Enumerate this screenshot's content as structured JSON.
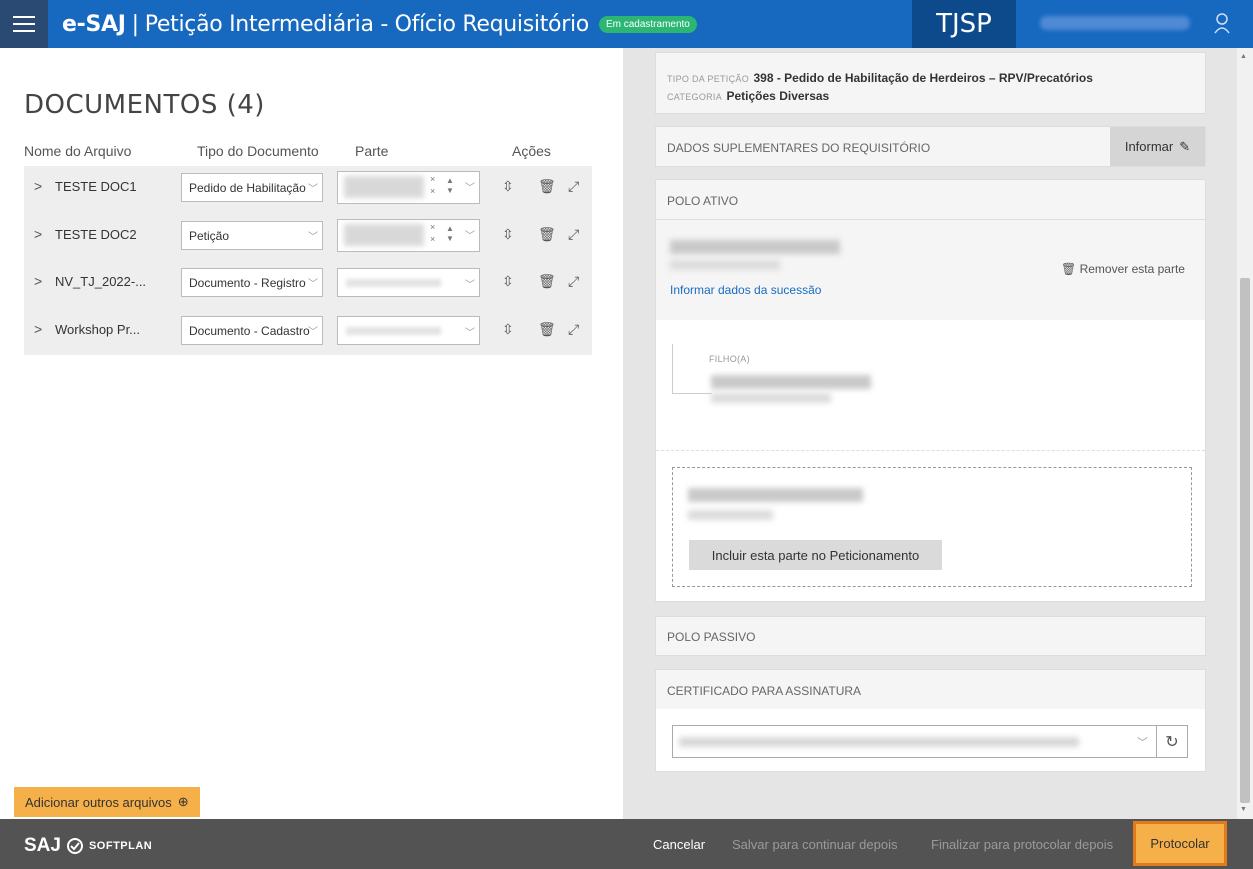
{
  "header": {
    "app_name": "e-SAJ",
    "separator": "|",
    "page_title": "Petição Intermediária - Ofício Requisitório",
    "status_badge": "Em cadastramento",
    "court": "TJSP"
  },
  "documents": {
    "title": "DOCUMENTOS (4)",
    "columns": [
      "Nome do Arquivo",
      "Tipo do Documento",
      "Parte",
      "Ações"
    ],
    "rows": [
      {
        "name": "TESTE DOC1",
        "type": "Pedido de Habilitação"
      },
      {
        "name": "TESTE DOC2",
        "type": "Petição"
      },
      {
        "name": "NV_TJ_2022-...",
        "type": "Documento - Registro"
      },
      {
        "name": "Workshop Pr...",
        "type": "Documento - Cadastro"
      }
    ],
    "add_button": "Adicionar outros arquivos"
  },
  "petition": {
    "tipo_label": "TIPO DA PETIÇÃO",
    "tipo_value": "398 - Pedido de Habilitação de Herdeiros – RPV/Precatórios",
    "categoria_label": "CATEGORIA",
    "categoria_value": "Petições Diversas"
  },
  "sections": {
    "dados_supl": "DADOS SUPLEMENTARES DO REQUISITÓRIO",
    "informar": "Informar",
    "polo_ativo": "POLO ATIVO",
    "informar_sucessao": "Informar dados da sucessão",
    "remover": "Remover esta parte",
    "filho_label": "FILHO(A)",
    "incluir": "Incluir esta parte no Peticionamento",
    "polo_passivo": "POLO PASSIVO",
    "certificado": "CERTIFICADO PARA ASSINATURA"
  },
  "footer": {
    "logo_saj": "SAJ",
    "logo_softplan": "SOFTPLAN",
    "cancelar": "Cancelar",
    "salvar": "Salvar para continuar depois",
    "finalizar": "Finalizar para protocolar depois",
    "protocolar": "Protocolar"
  },
  "colors": {
    "header_blue": "#1769c0",
    "accent_orange": "#f6b04a",
    "badge_green": "#2bb673",
    "link_blue": "#1a6bbf"
  }
}
